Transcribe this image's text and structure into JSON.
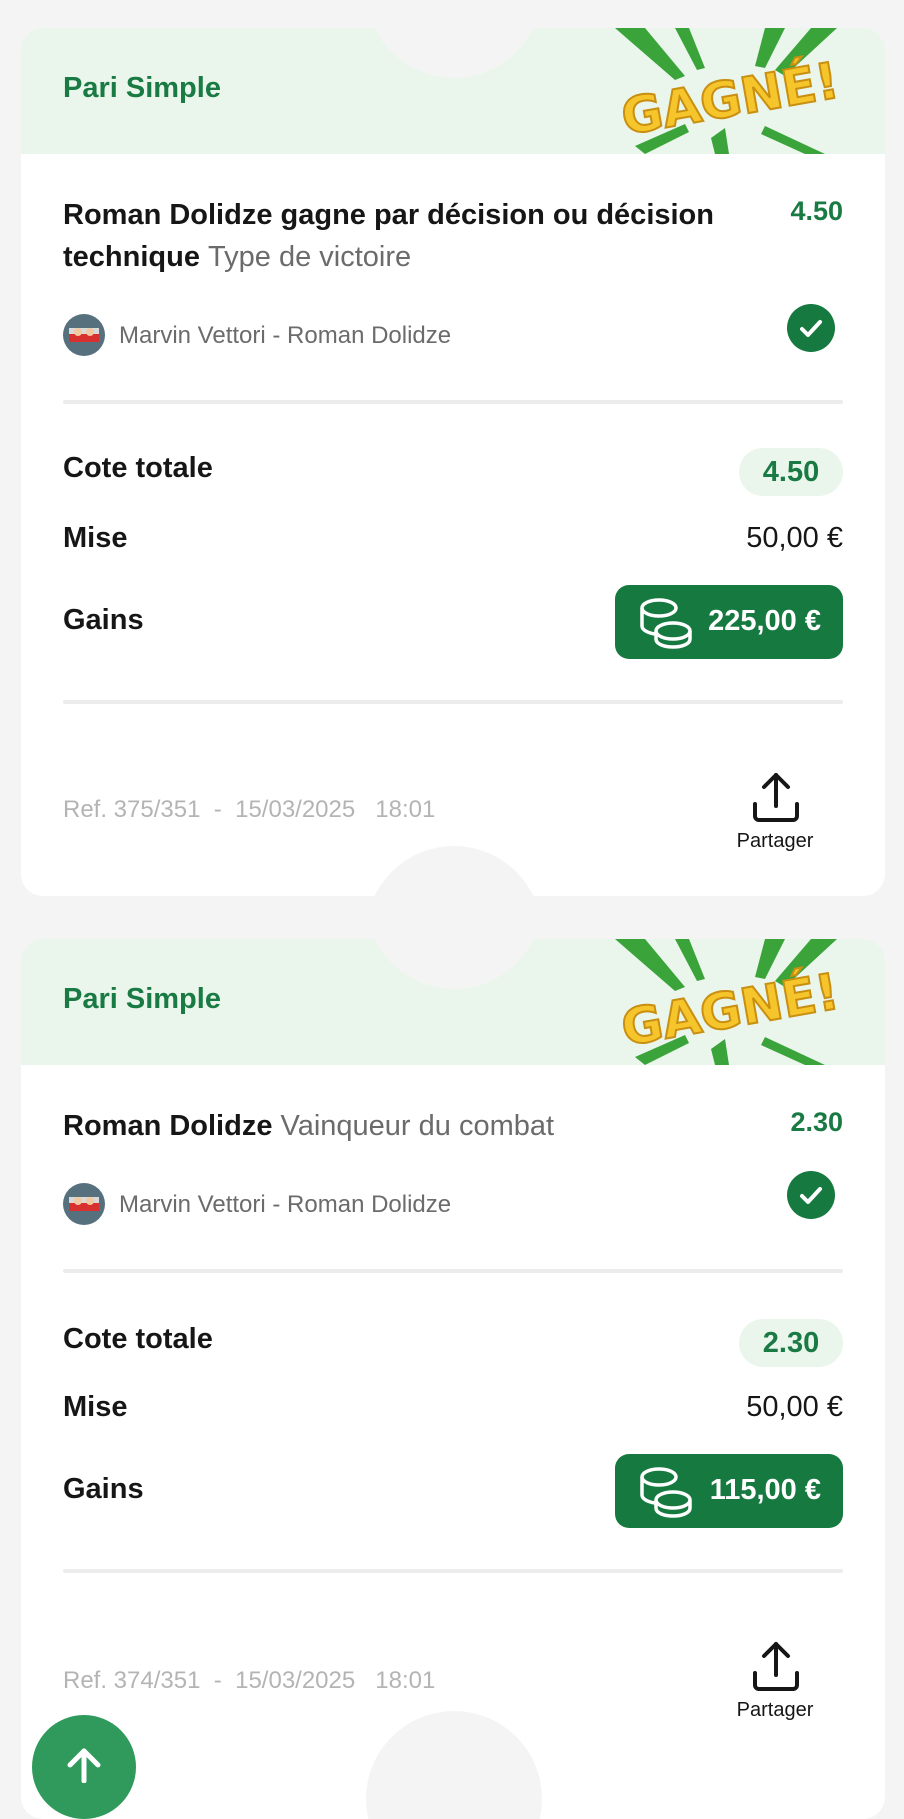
{
  "colors": {
    "brand_green": "#1a7a43",
    "header_bg": "#eaf6ec",
    "gains_bg": "#167a40",
    "page_bg": "#f4f4f4",
    "badge_yellow": "#f6c52b"
  },
  "tickets": [
    {
      "type": "Pari Simple",
      "badge": "GAGNÉ!",
      "selection_name": "Roman Dolidze gagne par décision ou décision technique",
      "selection_market": "Type de victoire",
      "selection_odds": "4.50",
      "event": "Marvin Vettori - Roman Dolidze",
      "status_icon": "check-circle-icon",
      "total_odds_label": "Cote totale",
      "total_odds": "4.50",
      "stake_label": "Mise",
      "stake": "50,00 €",
      "gains_label": "Gains",
      "gains": "225,00 €",
      "ref": "Ref. 375/351",
      "date": "15/03/2025",
      "time": "18:01",
      "share_label": "Partager"
    },
    {
      "type": "Pari Simple",
      "badge": "GAGNÉ!",
      "selection_name": "Roman Dolidze",
      "selection_market": "Vainqueur du combat",
      "selection_odds": "2.30",
      "event": "Marvin Vettori - Roman Dolidze",
      "status_icon": "check-circle-icon",
      "total_odds_label": "Cote totale",
      "total_odds": "2.30",
      "stake_label": "Mise",
      "stake": "50,00 €",
      "gains_label": "Gains",
      "gains": "115,00 €",
      "ref": "Ref. 374/351",
      "date": "15/03/2025",
      "time": "18:01",
      "share_label": "Partager"
    }
  ],
  "fab": {
    "icon": "arrow-up-icon"
  }
}
